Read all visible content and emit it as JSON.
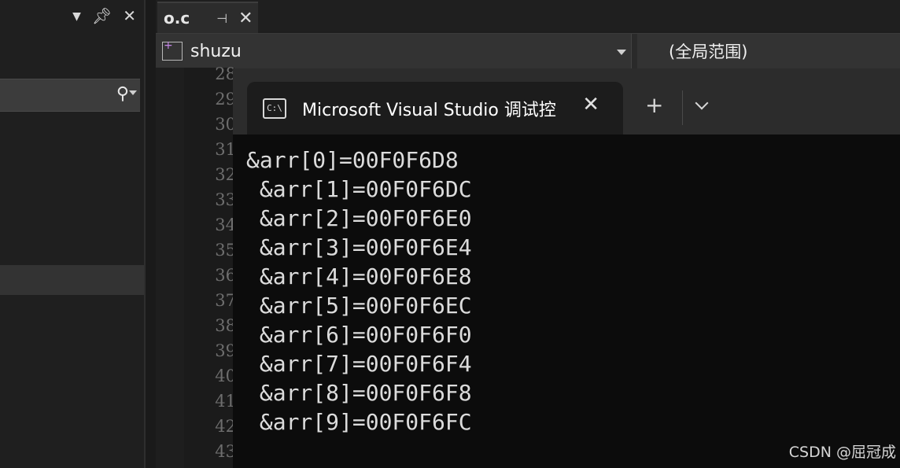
{
  "left_panel": {
    "header_icons": [
      "dropdown-icon",
      "pin-icon",
      "close-icon"
    ]
  },
  "editor": {
    "tab": {
      "name": "o.c"
    },
    "nav": {
      "member": "shuzu",
      "scope": "(全局范围)"
    },
    "line_numbers": [
      "28",
      "29",
      "30",
      "31",
      "32",
      "33",
      "34",
      "35",
      "36",
      "37",
      "38",
      "39",
      "40",
      "41",
      "42",
      "43"
    ]
  },
  "console": {
    "title": "Microsoft Visual Studio 调试控",
    "icon_text": "C:\\",
    "output_lines": [
      "&arr[0]=00F0F6D8",
      " &arr[1]=00F0F6DC",
      " &arr[2]=00F0F6E0",
      " &arr[3]=00F0F6E4",
      " &arr[4]=00F0F6E8",
      " &arr[5]=00F0F6EC",
      " &arr[6]=00F0F6F0",
      " &arr[7]=00F0F6F4",
      " &arr[8]=00F0F6F8",
      " &arr[9]=00F0F6FC"
    ]
  },
  "watermark": "CSDN @屈冠成"
}
